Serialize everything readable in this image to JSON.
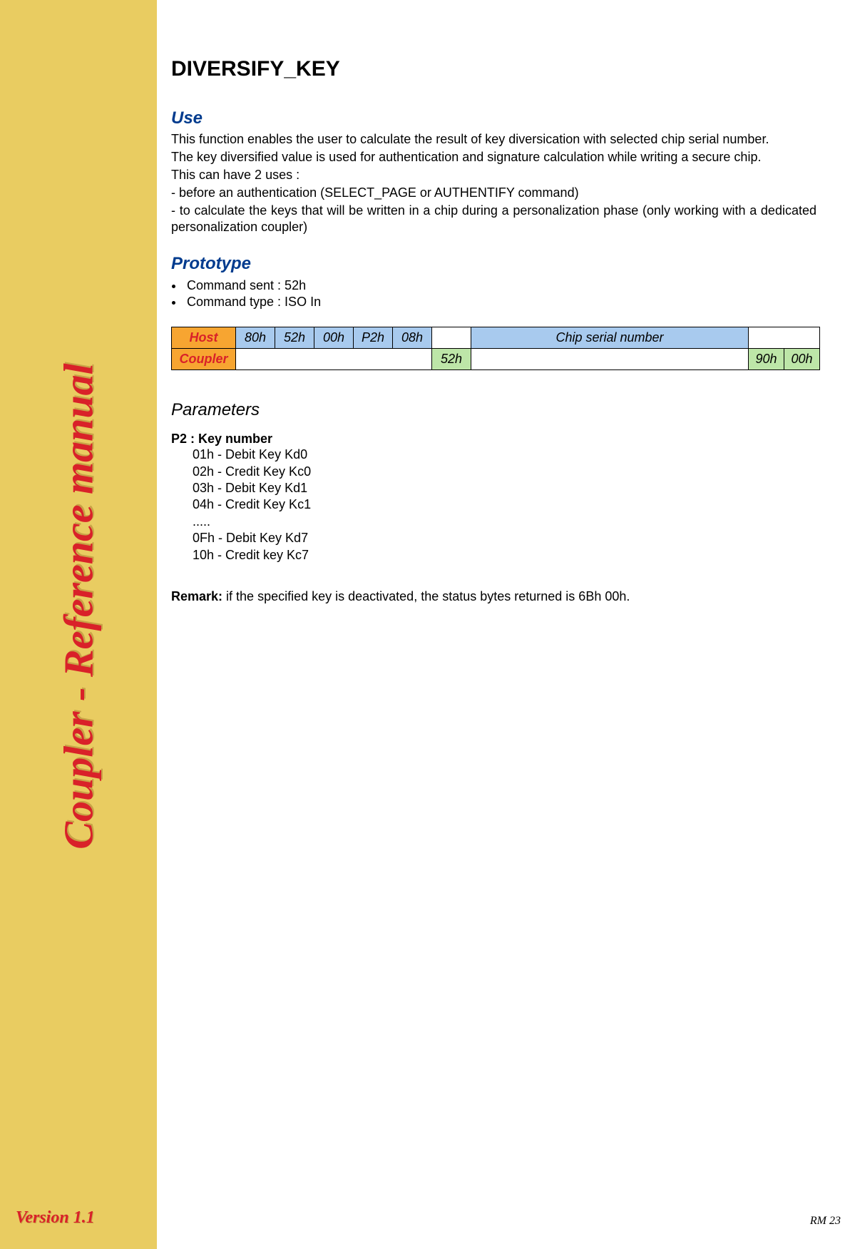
{
  "sidebar": {
    "title": "Coupler - Reference manual",
    "version": "Version 1.1"
  },
  "page": {
    "title": "DIVERSIFY_KEY",
    "page_number": "RM 23"
  },
  "use": {
    "heading": "Use",
    "p1": "This function enables the user to calculate the result of key diversication with selected chip serial number.",
    "p2": "The key diversified value is used for authentication and signature calculation while writing a secure chip.",
    "p3": "This can have 2 uses :",
    "p4": "- before an authentication (SELECT_PAGE or AUTHENTIFY command)",
    "p5": "- to calculate the keys that will be written in a chip during a personalization phase (only working with a dedicated personalization coupler)"
  },
  "prototype": {
    "heading": "Prototype",
    "bullets": [
      "Command sent : 52h",
      "Command type : ISO In"
    ],
    "table": {
      "host_label": "Host",
      "coupler_label": "Coupler",
      "host_cells": {
        "c1": "80h",
        "c2": "52h",
        "c3": "00h",
        "c4": "P2h",
        "c5": "08h",
        "c6": "",
        "c7": "Chip serial number",
        "c8": ""
      },
      "coupler_cells": {
        "c1": "",
        "c2": "52h",
        "c3": "",
        "c4": "90h",
        "c5": "00h"
      }
    }
  },
  "parameters": {
    "heading": "Parameters",
    "title": "P2 : Key number",
    "items": [
      "01h - Debit Key Kd0",
      "02h - Credit Key Kc0",
      "03h - Debit Key Kd1",
      "04h - Credit Key Kc1",
      "   .....",
      "0Fh - Debit Key Kd7",
      "10h - Credit key Kc7"
    ]
  },
  "remark": {
    "label": "Remark:",
    "text": " if the specified key is deactivated, the status bytes returned is 6Bh 00h."
  }
}
